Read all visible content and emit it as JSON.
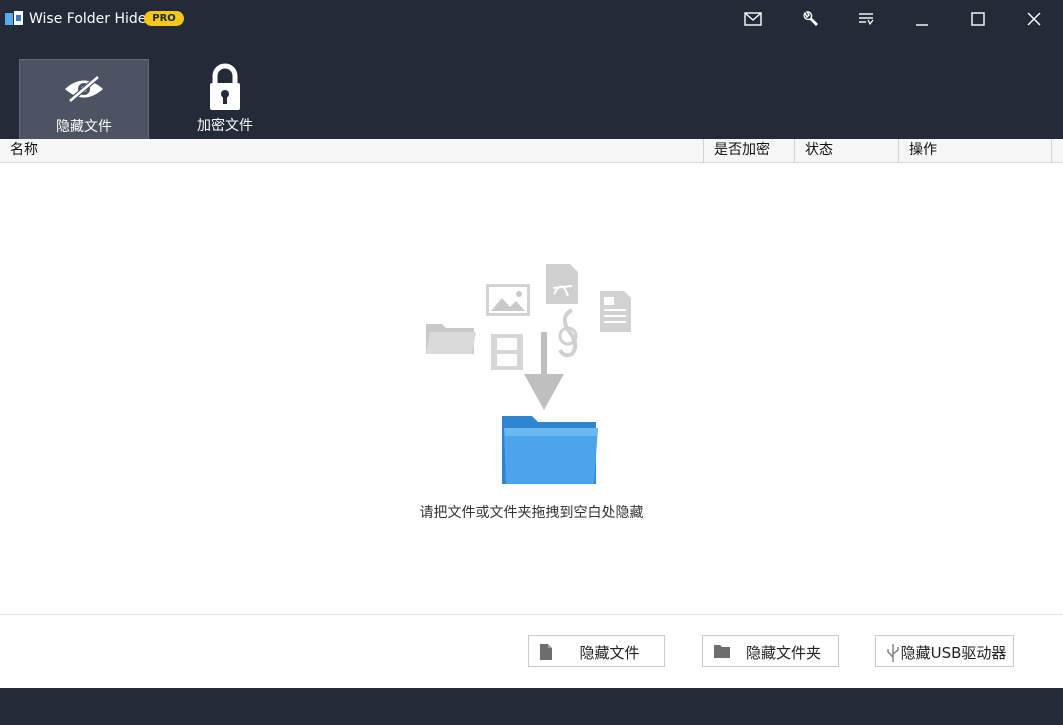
{
  "window": {
    "title": "Wise Folder Hider",
    "badge": "PRO",
    "controls": [
      "mail-icon",
      "tools-icon",
      "menu-icon",
      "minimize-icon",
      "maximize-icon",
      "close-icon"
    ]
  },
  "tabs": [
    {
      "label": "隐藏文件",
      "icon": "eye-hidden-icon",
      "active": true
    },
    {
      "label": "加密文件",
      "icon": "lock-icon",
      "active": false
    }
  ],
  "table": {
    "columns": [
      "名称",
      "是否加密",
      "状态",
      "操作"
    ],
    "rows": []
  },
  "empty_state": {
    "hint": "请把文件或文件夹拖拽到空白处隐藏"
  },
  "actions": [
    {
      "label": "隐藏文件",
      "icon": "file-icon"
    },
    {
      "label": "隐藏文件夹",
      "icon": "folder-icon"
    },
    {
      "label": "隐藏USB驱动器",
      "icon": "usb-icon"
    }
  ],
  "colors": {
    "chrome": "#232a38",
    "active_tab": "#4c5362",
    "badge": "#f3c81a",
    "folder": "#3a9ae0"
  }
}
